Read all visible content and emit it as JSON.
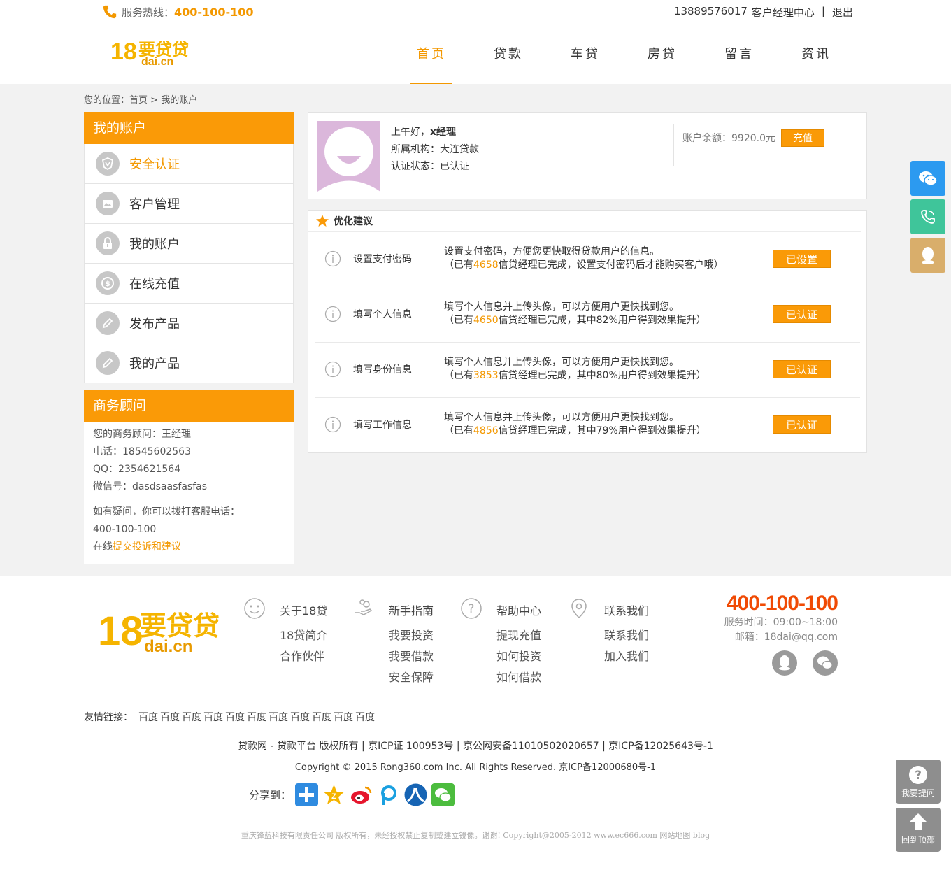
{
  "topbar": {
    "hotline_label": "服务热线：",
    "hotline_number": "400-100-100",
    "phone": "13889576017",
    "center_link": "客户经理中心",
    "separator": "|",
    "logout": "退出"
  },
  "logo": {
    "text_big": "18要贷贷",
    "text_small": "dai.cn"
  },
  "nav": {
    "items": [
      {
        "label": "首页"
      },
      {
        "label": "贷款"
      },
      {
        "label": "车贷"
      },
      {
        "label": "房贷"
      },
      {
        "label": "留言"
      },
      {
        "label": "资讯"
      }
    ]
  },
  "breadcrumb": {
    "prefix": "您的位置：",
    "home": "首页",
    "sep": " > ",
    "current": "我的账户"
  },
  "sidebar": {
    "title": "我的账户",
    "items": [
      {
        "label": "安全认证",
        "icon": "shield-icon"
      },
      {
        "label": "客户管理",
        "icon": "card-icon"
      },
      {
        "label": "我的账户",
        "icon": "lock-icon"
      },
      {
        "label": "在线充值",
        "icon": "coin-icon"
      },
      {
        "label": "发布产品",
        "icon": "pencil-icon"
      },
      {
        "label": "我的产品",
        "icon": "pencil-icon"
      }
    ]
  },
  "advisor": {
    "title": "商务顾问",
    "name_line": "您的商务顾问：王经理",
    "tel_line": "电话：18545602563",
    "qq_line": "QQ：2354621564",
    "wechat_line": "微信号：dasdsaasfasfas",
    "question_line": "如有疑问，你可以拨打客服电话：",
    "service_number": "400-100-100",
    "online_prefix": "在线",
    "complaint_link": "提交投诉和建议"
  },
  "profile": {
    "greeting": "上午好，",
    "name": "x经理",
    "org_line": "所属机构：大连贷款",
    "status_line": "认证状态：已认证",
    "balance_line": "账户余额：9920.0元",
    "recharge_button": "充值"
  },
  "suggestions": {
    "title": "优化建议",
    "rows": [
      {
        "title": "设置支付密码",
        "desc1": "设置支付密码，方便您更快取得贷款用户的信息。",
        "desc2_pre": "（已有",
        "count": "4658",
        "desc2_post": "信贷经理已完成，设置支付密码后才能购买客户哦）",
        "button": "已设置"
      },
      {
        "title": "填写个人信息",
        "desc1": "填写个人信息并上传头像，可以方便用户更快找到您。",
        "desc2_pre": "（已有",
        "count": "4650",
        "desc2_post": "信贷经理已完成，其中82%用户得到效果提升）",
        "button": "已认证"
      },
      {
        "title": "填写身份信息",
        "desc1": "填写个人信息并上传头像，可以方便用户更快找到您。",
        "desc2_pre": "（已有",
        "count": "3853",
        "desc2_post": "信贷经理已完成，其中80%用户得到效果提升）",
        "button": "已认证"
      },
      {
        "title": "填写工作信息",
        "desc1": "填写个人信息并上传头像，可以方便用户更快找到您。",
        "desc2_pre": "（已有",
        "count": "4856",
        "desc2_post": "信贷经理已完成，其中79%用户得到效果提升）",
        "button": "已认证"
      }
    ]
  },
  "footer": {
    "cols": [
      {
        "title": "关于18贷",
        "icon": "smile-icon",
        "links": [
          "18贷简介",
          "合作伙伴"
        ]
      },
      {
        "title": "新手指南",
        "icon": "hand-coin-icon",
        "links": [
          "我要投资",
          "我要借款",
          "安全保障"
        ]
      },
      {
        "title": "帮助中心",
        "icon": "question-icon",
        "links": [
          "提现充值",
          "如何投资",
          "如何借款"
        ]
      },
      {
        "title": "联系我们",
        "icon": "location-icon",
        "links": [
          "联系我们",
          "加入我们"
        ]
      }
    ],
    "contact_number": "400-100-100",
    "service_time": "服务时间：09:00~18:00",
    "email": "邮箱：18dai@qq.com",
    "friends_label": "友情链接：",
    "friends": [
      "百度",
      "百度",
      "百度",
      "百度",
      "百度",
      "百度",
      "百度",
      "百度",
      "百度",
      "百度",
      "百度"
    ],
    "copyright1": "贷款网 - 贷款平台 版权所有 | 京ICP证 100953号 | 京公网安备11010502020657 | 京ICP备12025643号-1",
    "copyright2": "Copyright © 2015 Rong360.com Inc. All Rights Reserved. 京ICP备12000680号-1",
    "share_label": "分享到：",
    "copyright3": "重庆锋蓝科技有限责任公司 版权所有，未经授权禁止复制或建立镜像。谢谢! Copyright@2005-2012 www.ec666.com 网站地图 blog"
  },
  "float": {
    "ask": "我要提问",
    "top": "回到顶部"
  },
  "colors": {
    "accent": "#fa9a07",
    "wechat": "#2c9af0",
    "phone": "#3fc59a",
    "qq": "#d9ae6b"
  }
}
